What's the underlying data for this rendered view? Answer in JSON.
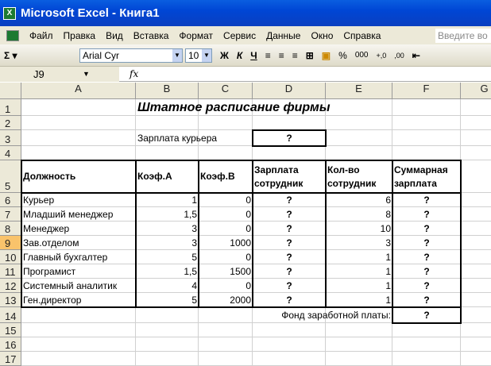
{
  "window": {
    "title": "Microsoft Excel - Книга1"
  },
  "menu": [
    "Файл",
    "Правка",
    "Вид",
    "Вставка",
    "Формат",
    "Сервис",
    "Данные",
    "Окно",
    "Справка"
  ],
  "help_placeholder": "Введите во",
  "toolbar": {
    "autosum": "Σ ▾",
    "font": "Arial Cyr",
    "size": "10",
    "bold": "Ж",
    "italic": "К",
    "underline": "Ч",
    "percent": "%",
    "thousands": "000",
    "inc_dec": "+,0",
    "dec_dec": ",00"
  },
  "formula_bar": {
    "name_box": "J9",
    "fx": "fx",
    "value": ""
  },
  "columns": [
    "A",
    "B",
    "C",
    "D",
    "E",
    "F",
    "G"
  ],
  "rows": [
    "1",
    "2",
    "3",
    "4",
    "5",
    "6",
    "7",
    "8",
    "9",
    "10",
    "11",
    "12",
    "13",
    "14",
    "15",
    "16",
    "17"
  ],
  "selected_row": "9",
  "sheet": {
    "title": "Штатное расписание фирмы",
    "courier_label": "Зарплата курьера",
    "courier_value": "?",
    "headers": [
      "Должность",
      "Коэф.А",
      "Коэф.В",
      "Зарплата сотрудник",
      "Кол-во сотрудник",
      "Суммарная зарплата"
    ],
    "data": [
      [
        "Курьер",
        "1",
        "0",
        "?",
        "6",
        "?"
      ],
      [
        "Младший менеджер",
        "1,5",
        "0",
        "?",
        "8",
        "?"
      ],
      [
        "Менеджер",
        "3",
        "0",
        "?",
        "10",
        "?"
      ],
      [
        "Зав.отделом",
        "3",
        "1000",
        "?",
        "3",
        "?"
      ],
      [
        "Главный бухгалтер",
        "5",
        "0",
        "?",
        "1",
        "?"
      ],
      [
        "Програмист",
        "1,5",
        "1500",
        "?",
        "1",
        "?"
      ],
      [
        "Системный аналитик",
        "4",
        "0",
        "?",
        "1",
        "?"
      ],
      [
        "Ген.директор",
        "5",
        "2000",
        "?",
        "1",
        "?"
      ]
    ],
    "fund_label": "Фонд заработной платы:",
    "fund_value": "?"
  }
}
